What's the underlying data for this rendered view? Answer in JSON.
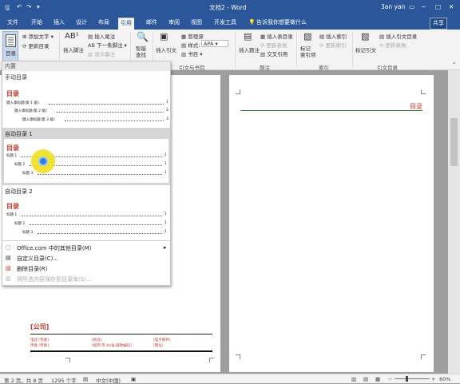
{
  "titlebar": {
    "doc_title": "文档2 - Word",
    "user": "3an yan"
  },
  "tabs": [
    "文件",
    "开始",
    "插入",
    "设计",
    "布局",
    "引用",
    "邮件",
    "审阅",
    "视图",
    "开发工具"
  ],
  "active_tab": "引用",
  "tell_me": "告诉我你想要做什么",
  "share": "共享",
  "ribbon": {
    "toc_button": "目录",
    "add_text": "添加文字",
    "update_toc": "更新目录",
    "insert_footnote": "插入脚注",
    "insert_endnote": "插入尾注",
    "next_footnote": "下一条脚注",
    "show_notes": "显示备注",
    "smart_lookup": "智能\n查找",
    "insert_citation": "插入引文",
    "manage_sources": "管理源",
    "style_label": "样式:",
    "style_value": "APA",
    "bibliography": "书目",
    "group_citations": "引文与书目",
    "insert_caption": "插入题注",
    "insert_table_of_figures": "插入表目录",
    "update_table": "更新表格",
    "cross_reference": "交叉引用",
    "group_captions": "题注",
    "mark_entry": "标记\n索引项",
    "insert_index": "插入索引",
    "update_index": "更新索引",
    "group_index": "索引",
    "mark_citation": "标记引文",
    "insert_table_of_authorities": "插入引文目录",
    "update_table2": "更新表格",
    "group_authorities": "引文目录"
  },
  "dropdown": {
    "section_builtin": "内置",
    "manual": {
      "label": "手动目录",
      "title": "目录",
      "lines": [
        "键入章标题(第 1 级)",
        "键入章标题(第 2 级)",
        "键入章标题(第 3 级)"
      ],
      "pages": [
        "1",
        "2",
        "3"
      ]
    },
    "auto1": {
      "label": "自动目录 1",
      "title": "目录",
      "lines": [
        "标题 1",
        "标题 2",
        "标题 3"
      ],
      "pages": [
        "1",
        "1",
        "1"
      ]
    },
    "auto2": {
      "label": "自动目录 2",
      "title": "目录",
      "lines": [
        "标题 1",
        "标题 2",
        "标题 3"
      ],
      "pages": [
        "1",
        "1",
        "1"
      ]
    },
    "menu": [
      {
        "label": "Office.com 中的其他目录(M)",
        "disabled": false
      },
      {
        "label": "自定义目录(C)...",
        "disabled": false
      },
      {
        "label": "删除目录(R)",
        "disabled": false
      },
      {
        "label": "将所选内容保存到目录库(S)...",
        "disabled": true
      }
    ]
  },
  "page_right": {
    "heading": "目录"
  },
  "page_left": {
    "company": "[公司]",
    "row1": [
      "电话 [传真]",
      "[地址]",
      "[电子邮件]"
    ],
    "row2": [
      "传真 [传真]",
      "[城市/市,州/省,邮政编码]",
      "[网址]"
    ]
  },
  "status": {
    "page": "第 2 页，共 8 页",
    "words": "1295 个字",
    "lang": "中文(中国)",
    "zoom": "60%"
  },
  "colors": {
    "brand": "#2b579a",
    "toc_red": "#c0392b",
    "accent_green": "#2e7d32",
    "cursor_yellow": "#f0e020"
  }
}
